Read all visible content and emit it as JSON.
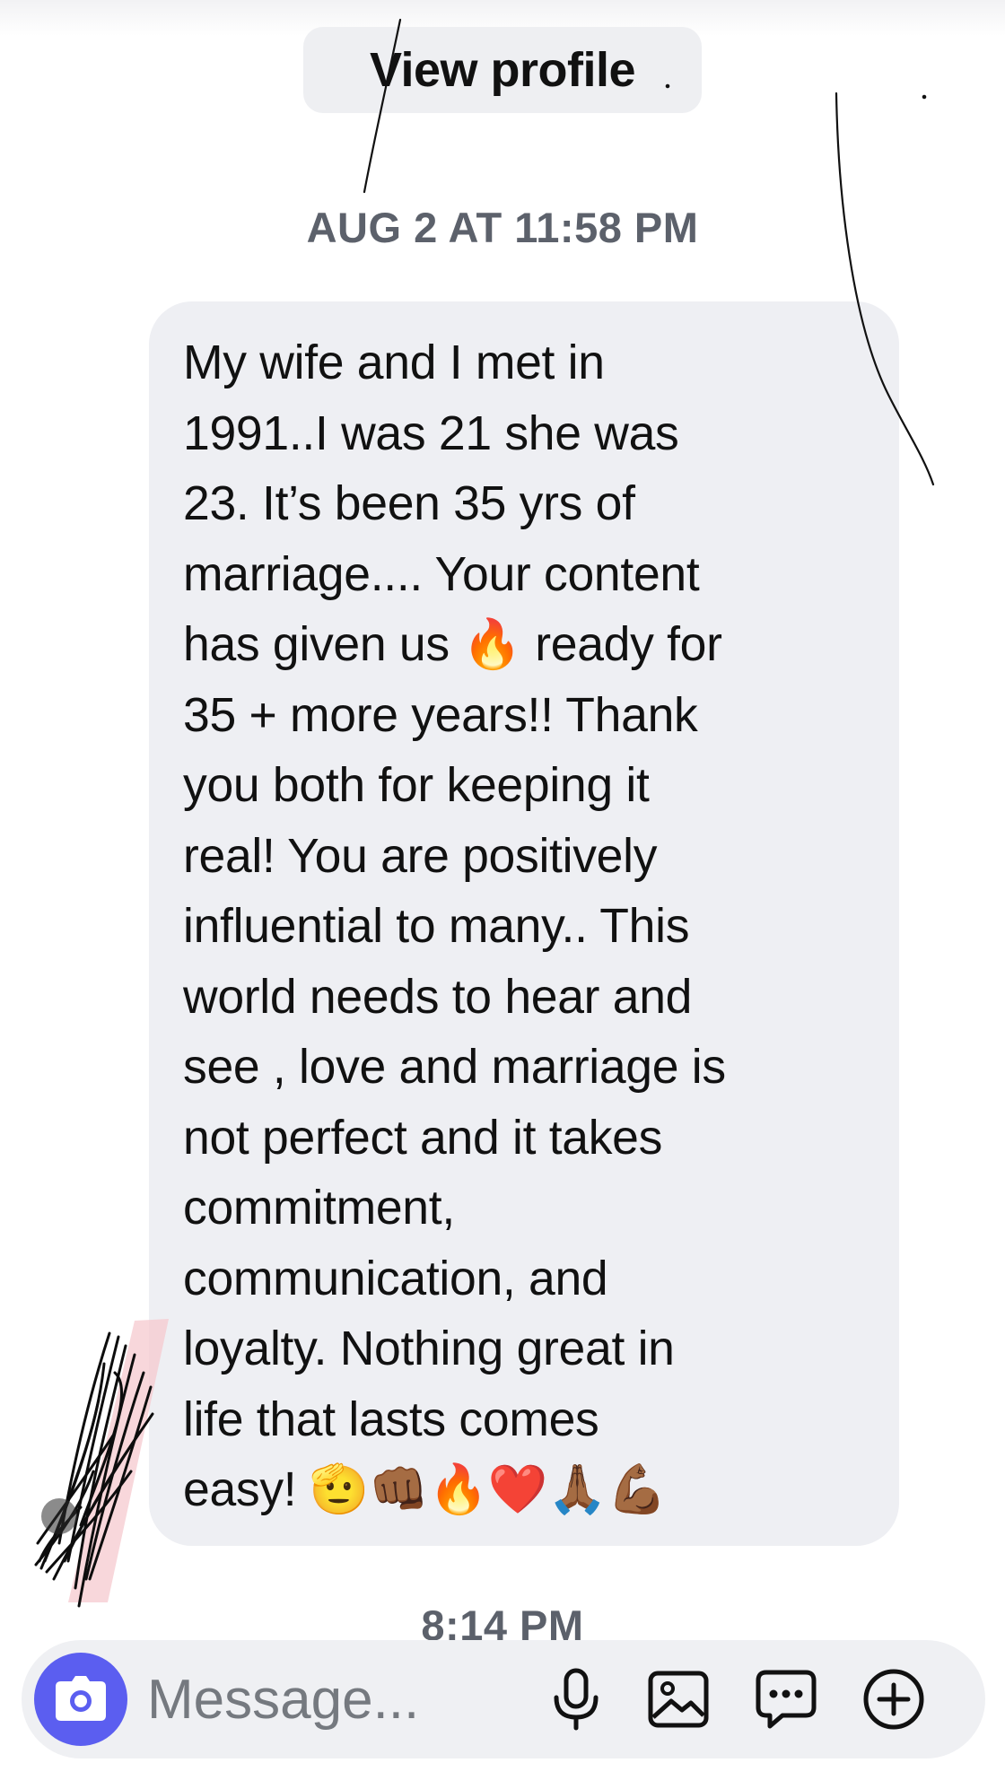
{
  "header": {
    "view_profile_label": "View profile"
  },
  "thread": {
    "timestamps": [
      "AUG 2 AT 11:58 PM",
      "8:14 PM"
    ],
    "message_text": "My wife and I met in\n1991..I was 21 she was\n23.  It’s been 35 yrs of\nmarriage.... Your content\nhas given us 🔥 ready for\n35 + more years!! Thank\nyou both for keeping it\nreal!  You are positively\ninfluential to many..  This\nworld needs to hear and\nsee , love and marriage is\nnot perfect and it takes\ncommitment,\ncommunication,  and\nloyalty.  Nothing great in\nlife that lasts comes\neasy!   🫡👊🏾🔥❤️🙏🏾💪🏾"
  },
  "composer": {
    "placeholder": "Message...",
    "icons": [
      "camera-icon",
      "microphone-icon",
      "gallery-icon",
      "sticker-icon",
      "plus-icon"
    ],
    "accent_color": "#5b5ef0"
  }
}
